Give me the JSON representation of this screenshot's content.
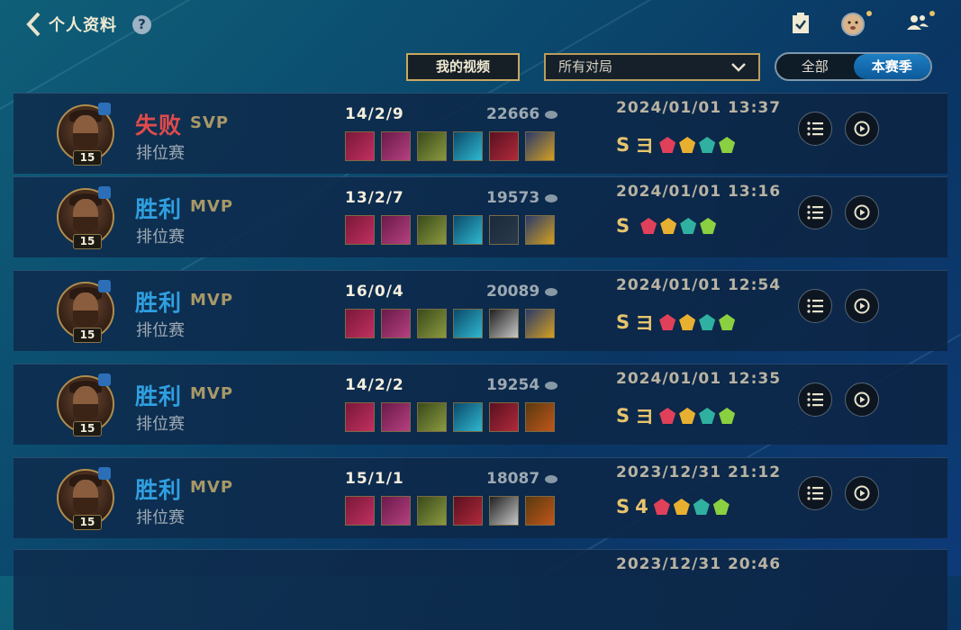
{
  "header": {
    "back_label": "个人资料",
    "help_label": "?"
  },
  "controls": {
    "video_button": "我的视频",
    "match_filter": "所有对局",
    "season_tabs": [
      "全部",
      "本赛季"
    ]
  },
  "matches": [
    {
      "result": "失败",
      "rank": "SVP",
      "mode": "排位赛",
      "level": "15",
      "kda": "14/2/9",
      "score": "22666",
      "datetime": "2024/01/01 13:37",
      "grade": [
        "S",
        "ヨ"
      ]
    },
    {
      "result": "胜利",
      "rank": "MVP",
      "mode": "排位赛",
      "level": "15",
      "kda": "13/2/7",
      "score": "19573",
      "datetime": "2024/01/01 13:16",
      "grade": [
        "S",
        ""
      ]
    },
    {
      "result": "胜利",
      "rank": "MVP",
      "mode": "排位赛",
      "level": "15",
      "kda": "16/0/4",
      "score": "20089",
      "datetime": "2024/01/01 12:54",
      "grade": [
        "S",
        "ヨ"
      ]
    },
    {
      "result": "胜利",
      "rank": "MVP",
      "mode": "排位赛",
      "level": "15",
      "kda": "14/2/2",
      "score": "19254",
      "datetime": "2024/01/01 12:35",
      "grade": [
        "S",
        "ヨ"
      ]
    },
    {
      "result": "胜利",
      "rank": "MVP",
      "mode": "排位赛",
      "level": "15",
      "kda": "15/1/1",
      "score": "18087",
      "datetime": "2023/12/31 21:12",
      "grade": [
        "S",
        "4"
      ]
    }
  ],
  "partial_row": {
    "datetime": "2023/12/31 20:46"
  }
}
